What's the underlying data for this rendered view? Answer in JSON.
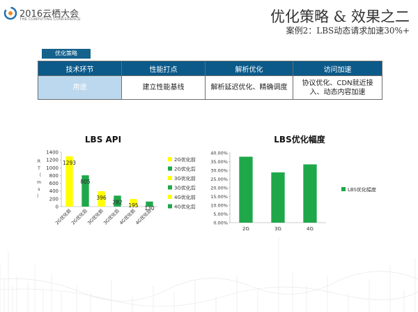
{
  "header": {
    "logo_text": "2016云栖大会",
    "logo_sub": "THE COMPUTING CONFERENCE",
    "title": "优化策略 & 效果之二",
    "subtitle": "案例2：LBS动态请求加速30%+"
  },
  "tag_label": "优化策略",
  "table": {
    "headers": [
      "技术环节",
      "性能打点",
      "解析优化",
      "访问加速"
    ],
    "row": [
      "用途",
      "建立性能基线",
      "解析延迟优化、精确调度",
      "协议优化、CDN就近接入、动态内容加速"
    ]
  },
  "colors": {
    "yellow": "#ffff00",
    "green": "#1fa84a",
    "header_blue": "#0b5a8a",
    "tag_blue": "#15628c"
  },
  "chart_data": [
    {
      "type": "bar",
      "title": "LBS API",
      "ylabel": "RT（ms）",
      "ylim": [
        0,
        1400
      ],
      "yticks": [
        0,
        200,
        400,
        600,
        800,
        1000,
        1200,
        1400
      ],
      "categories": [
        "2G优化前",
        "2G优化后",
        "3G优化前",
        "3G优化后",
        "4G优化前",
        "4G优化后"
      ],
      "values": [
        1293,
        805,
        396,
        282,
        195,
        130
      ],
      "data_labels": [
        "1293",
        "805",
        "396",
        "282",
        "195",
        "130"
      ],
      "bar_colors": [
        "#ffff00",
        "#1fa84a",
        "#ffff00",
        "#1fa84a",
        "#ffff00",
        "#1fa84a"
      ],
      "legend": [
        "2G优化前",
        "2G优化后",
        "3G优化前",
        "3G优化后",
        "4G优化前",
        "4G优化后"
      ],
      "legend_position": "right"
    },
    {
      "type": "bar",
      "title": "LBS优化幅度",
      "ylim": [
        0,
        0.4
      ],
      "yticks": [
        "0.00%",
        "5.00%",
        "10.00%",
        "15.00%",
        "20.00%",
        "25.00%",
        "30.00%",
        "35.00%",
        "40.00%"
      ],
      "categories": [
        "2G",
        "3G",
        "4G"
      ],
      "values": [
        0.378,
        0.288,
        0.334
      ],
      "series_name": "LBS优化幅度",
      "bar_color": "#1fa84a",
      "legend_position": "right"
    }
  ]
}
